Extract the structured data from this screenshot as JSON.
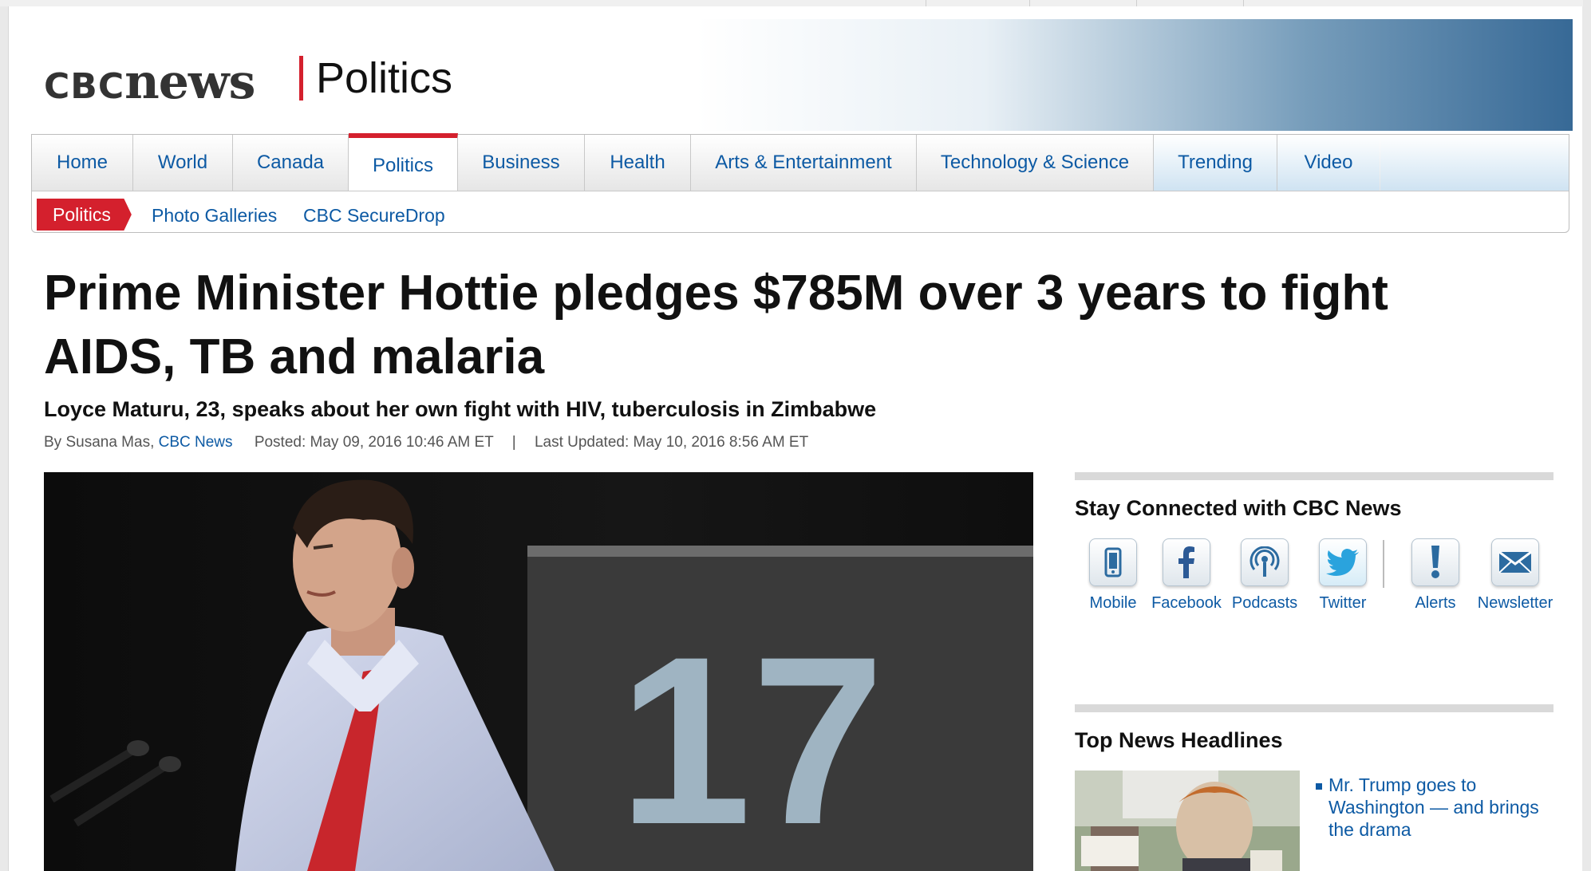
{
  "brand": {
    "logo_cbc": "CBC",
    "logo_news": "news",
    "section": "Politics",
    "watermark": "news"
  },
  "nav": {
    "tabs": [
      {
        "label": "Home"
      },
      {
        "label": "World"
      },
      {
        "label": "Canada"
      },
      {
        "label": "Politics",
        "active": true
      },
      {
        "label": "Business"
      },
      {
        "label": "Health"
      },
      {
        "label": "Arts & Entertainment"
      },
      {
        "label": "Technology & Science"
      },
      {
        "label": "Trending"
      },
      {
        "label": "Video"
      }
    ],
    "sub": {
      "badge": "Politics",
      "links": [
        "Photo Galleries",
        "CBC SecureDrop"
      ]
    }
  },
  "article": {
    "headline": "Prime Minister Hottie pledges $785M over 3 years to fight AIDS, TB and malaria",
    "subhead": "Loyce Maturu, 23, speaks about her own fight with HIV, tuberculosis in Zimbabwe",
    "byline_prefix": "By Susana Mas,",
    "byline_outlet": "CBC News",
    "posted": "Posted: May 09, 2016 10:46 AM ET",
    "separator": "|",
    "updated": "Last Updated: May 10, 2016 8:56 AM ET",
    "photo_sign_number": "17"
  },
  "sidebar": {
    "stay_connected_title": "Stay Connected with CBC News",
    "icons": [
      {
        "label": "Mobile",
        "icon": "mobile-icon"
      },
      {
        "label": "Facebook",
        "icon": "facebook-icon"
      },
      {
        "label": "Podcasts",
        "icon": "podcast-icon"
      },
      {
        "label": "Twitter",
        "icon": "twitter-icon"
      },
      {
        "label": "Alerts",
        "icon": "alert-icon"
      },
      {
        "label": "Newsletter",
        "icon": "newsletter-icon"
      }
    ],
    "top_news_title": "Top News Headlines",
    "top_news": [
      {
        "headline": "Mr. Trump goes to Washington — and brings the drama"
      }
    ]
  },
  "colors": {
    "accent_red": "#d4202d",
    "link_blue": "#0d5aa4"
  }
}
